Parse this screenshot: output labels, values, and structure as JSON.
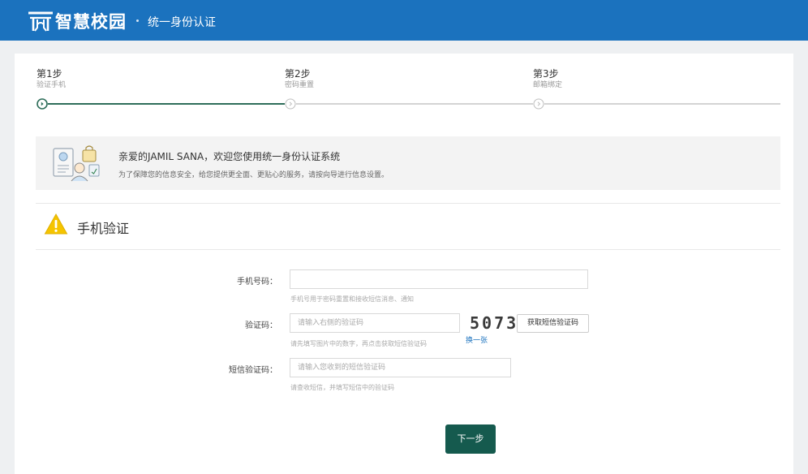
{
  "header": {
    "app_title": "智慧校园",
    "subtitle": "统一身份认证",
    "logo_icon": "school-gate-icon",
    "brand_color": "#1b72be"
  },
  "steps": [
    {
      "title": "第1步",
      "desc": "验证手机",
      "state": "active"
    },
    {
      "title": "第2步",
      "desc": "密码重置",
      "state": "pending"
    },
    {
      "title": "第3步",
      "desc": "邮箱绑定",
      "state": "pending"
    }
  ],
  "progress_color": "#2e6e5a",
  "welcome": {
    "title": "亲爱的JAMIL SANA，欢迎您使用统一身份认证系统",
    "desc": "为了保障您的信息安全，给您提供更全面、更贴心的服务，请按向导进行信息设置。",
    "icon": "user-security-illustration"
  },
  "section": {
    "title": "手机验证",
    "icon": "warning-triangle-icon"
  },
  "form": {
    "phone": {
      "label": "手机号码：",
      "value": "",
      "placeholder": "",
      "hint": "手机号用于密码重置和接收短信消息、通知"
    },
    "captcha": {
      "label": "验证码：",
      "placeholder": "请输入右侧的验证码",
      "hint": "请先填写图片中的数字，再点击获取短信验证码",
      "image_text": "5073",
      "refresh_label": "换一张",
      "sms_button_label": "获取短信验证码"
    },
    "sms_code": {
      "label": "短信验证码：",
      "placeholder": "请输入您收到的短信验证码",
      "hint": "请查收短信，并填写短信中的验证码"
    }
  },
  "next_button_label": "下一步",
  "next_button_color": "#155a4e"
}
